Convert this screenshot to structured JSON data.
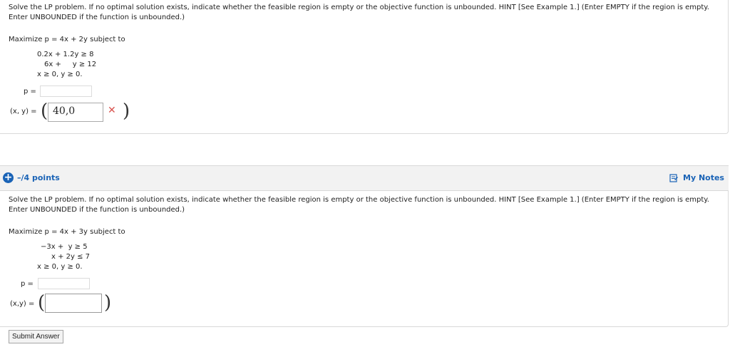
{
  "q1": {
    "instructions_line1": "Solve the LP problem. If no optimal solution exists, indicate whether the feasible region is empty or the objective function is unbounded. HINT [See Example 1.] (Enter EMPTY if the region is empty.",
    "instructions_line2": "Enter UNBOUNDED if the function is unbounded.)",
    "objective": "Maximize p = 4x + 2y subject to",
    "constraints": [
      "0.2x + 1.2y ≥ 8",
      "6x +     y ≥ 12",
      "x ≥ 0, y ≥ 0."
    ],
    "p_label": "p =",
    "p_value": "",
    "xy_label": "(x, y) =",
    "xy_value": "40,0",
    "open_paren": "(",
    "close_paren": ")",
    "status_mark": "✕",
    "status_color": "#d9534f"
  },
  "q2": {
    "points": "–/4 points",
    "my_notes": "My Notes",
    "instructions_line1": "Solve the LP problem. If no optimal solution exists, indicate whether the feasible region is empty or the objective function is unbounded. HINT [See Example 1.] (Enter EMPTY if the region is empty.",
    "instructions_line2": "Enter UNBOUNDED if the function is unbounded.)",
    "objective": "Maximize p = 4x + 3y subject to",
    "constraints": [
      "−3x +  y ≥ 5",
      "x + 2y ≤ 7",
      "x ≥ 0, y ≥ 0."
    ],
    "p_label": "p =",
    "p_value": "",
    "xy_label": "(x,y) =",
    "xy_value": "",
    "open_paren": "(",
    "close_paren": ")",
    "submit_label": "Submit Answer",
    "accent_color": "#1a63b6"
  },
  "icons": {
    "expand": "plus-circle-icon",
    "notes": "notepad-icon",
    "incorrect": "x-mark-icon"
  }
}
